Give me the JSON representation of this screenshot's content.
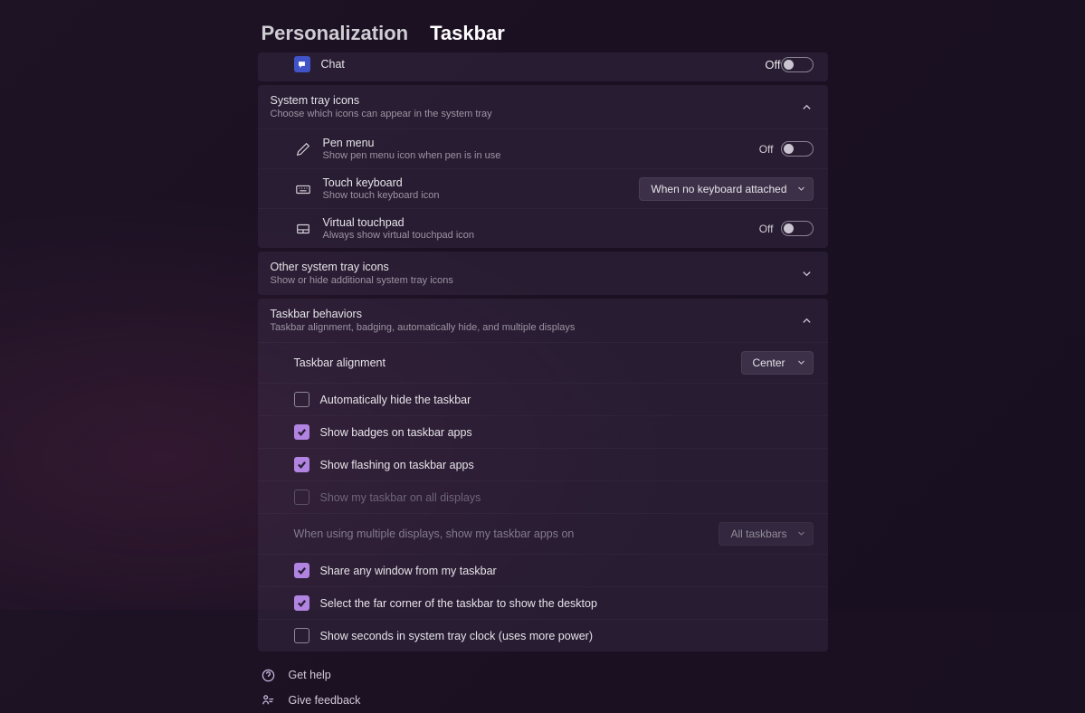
{
  "breadcrumb": {
    "parent": "Personalization",
    "current": "Taskbar"
  },
  "chat": {
    "label": "Chat",
    "state": "Off"
  },
  "tray": {
    "title": "System tray icons",
    "subtitle": "Choose which icons can appear in the system tray",
    "items": [
      {
        "title": "Pen menu",
        "subtitle": "Show pen menu icon when pen is in use",
        "state": "Off"
      },
      {
        "title": "Touch keyboard",
        "subtitle": "Show touch keyboard icon",
        "select": "When no keyboard attached"
      },
      {
        "title": "Virtual touchpad",
        "subtitle": "Always show virtual touchpad icon",
        "state": "Off"
      }
    ]
  },
  "other": {
    "title": "Other system tray icons",
    "subtitle": "Show or hide additional system tray icons"
  },
  "behaviors": {
    "title": "Taskbar behaviors",
    "subtitle": "Taskbar alignment, badging, automatically hide, and multiple displays",
    "alignment_label": "Taskbar alignment",
    "alignment_value": "Center",
    "autohide": "Automatically hide the taskbar",
    "badges": "Show badges on taskbar apps",
    "flashing": "Show flashing on taskbar apps",
    "all_displays": "Show my taskbar on all displays",
    "multi_label": "When using multiple displays, show my taskbar apps on",
    "multi_value": "All taskbars",
    "share": "Share any window from my taskbar",
    "farcorner": "Select the far corner of the taskbar to show the desktop",
    "seconds": "Show seconds in system tray clock (uses more power)"
  },
  "help": {
    "get_help": "Get help",
    "feedback": "Give feedback"
  }
}
